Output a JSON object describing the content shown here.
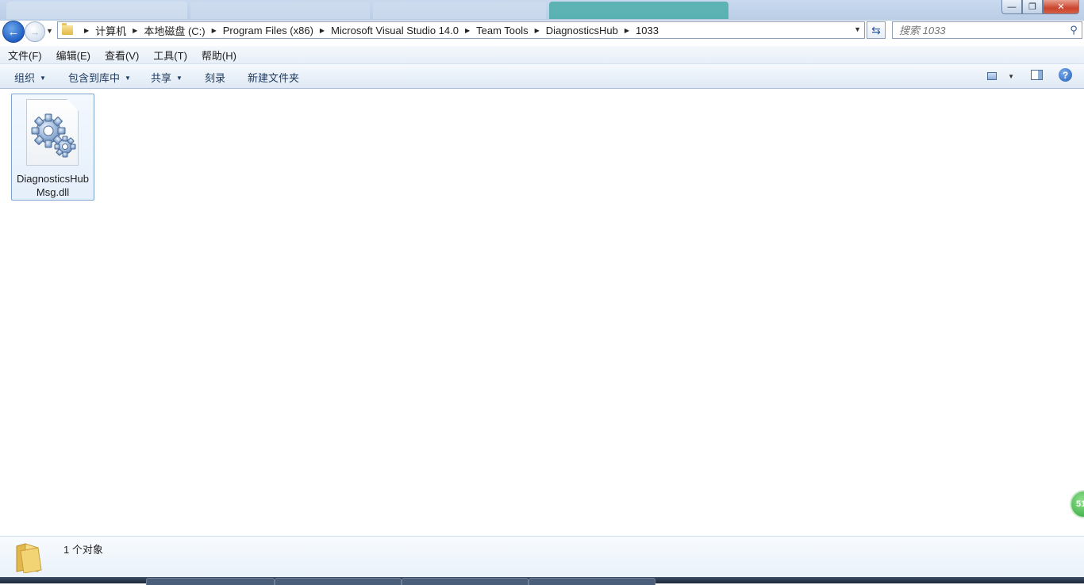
{
  "window": {
    "minimize_symbol": "—",
    "maximize_symbol": "❐",
    "close_symbol": "✕"
  },
  "nav": {
    "back_symbol": "←",
    "forward_symbol": "→",
    "history_symbol": "▼",
    "breadcrumbs": [
      "计算机",
      "本地磁盘 (C:)",
      "Program Files (x86)",
      "Microsoft Visual Studio 14.0",
      "Team Tools",
      "DiagnosticsHub",
      "1033"
    ],
    "refresh_symbol": "⇆",
    "dropdown_symbol": "▼"
  },
  "search": {
    "placeholder": "搜索 1033",
    "icon": "search-icon",
    "icon_glyph": "⚲"
  },
  "menu": {
    "items": [
      "文件(F)",
      "编辑(E)",
      "查看(V)",
      "工具(T)",
      "帮助(H)"
    ]
  },
  "commands": {
    "organize": "组织",
    "include_library": "包含到库中",
    "share": "共享",
    "burn": "刻录",
    "new_folder": "新建文件夹",
    "dropdown_symbol": "▼",
    "help_symbol": "?"
  },
  "files": [
    {
      "name": "DiagnosticsHubMsg.dll",
      "icon": "gear-icon"
    }
  ],
  "side_badge": "51",
  "details": {
    "count_text": "1 个对象"
  },
  "colors": {
    "accent": "#1d5bb8",
    "selection_border": "#7da2ce",
    "close_red": "#c9452d"
  }
}
